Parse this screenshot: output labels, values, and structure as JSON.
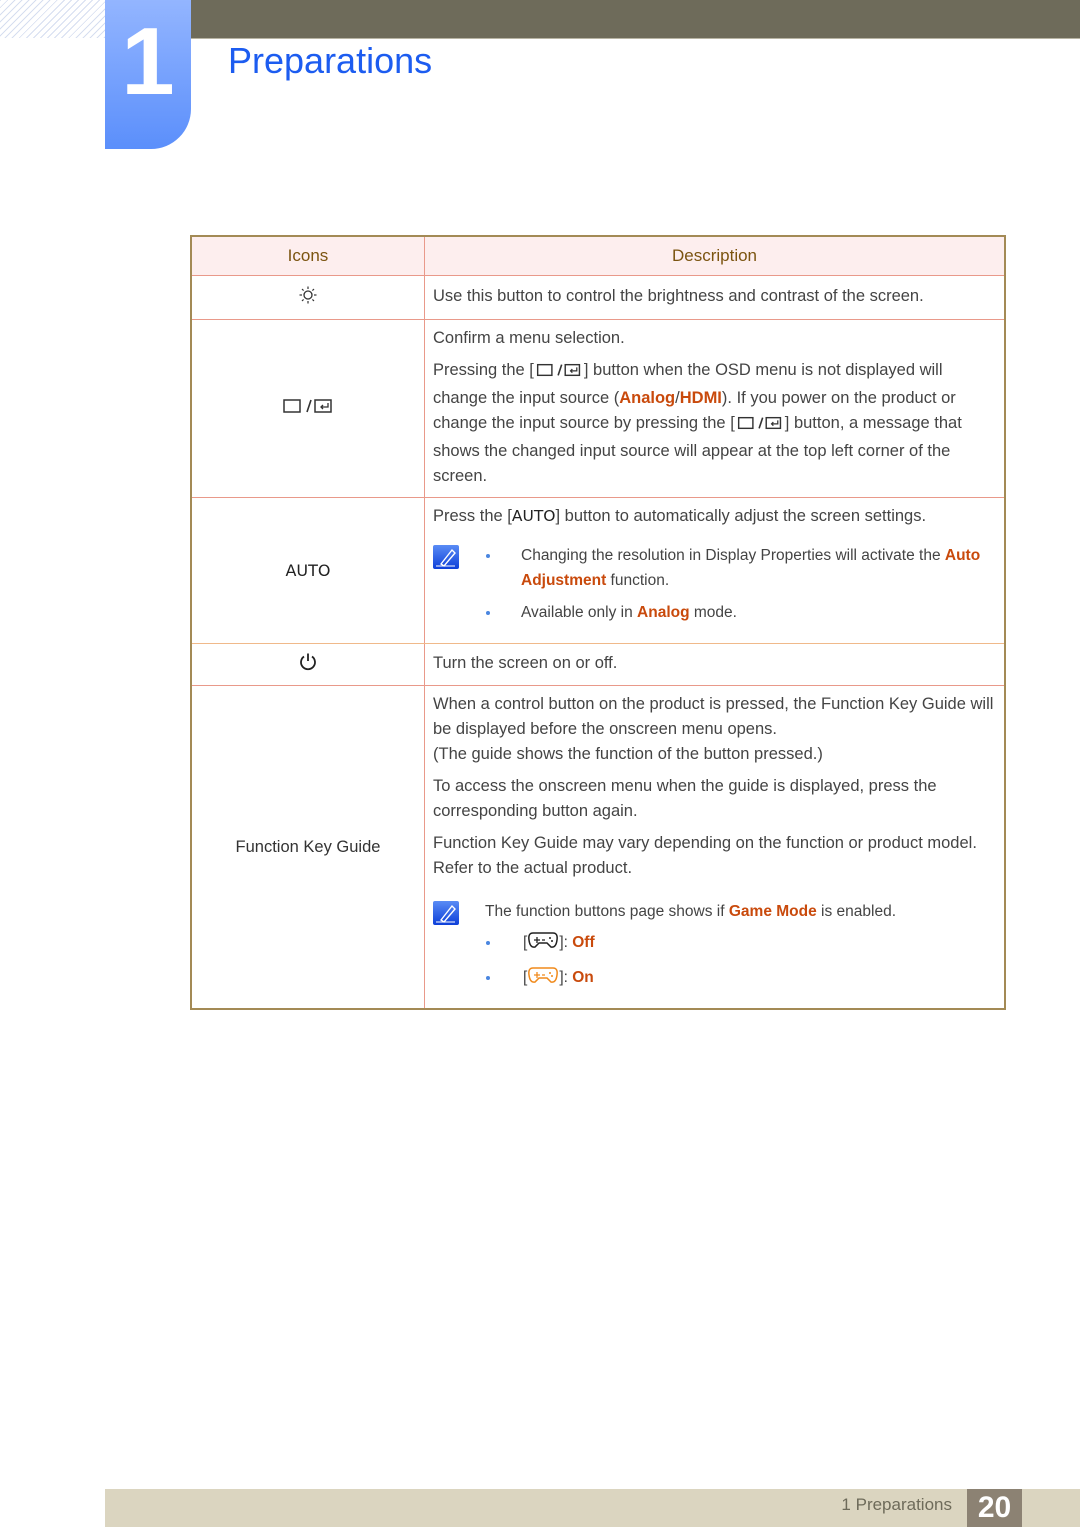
{
  "header": {
    "chapter_number": "1",
    "page_title": "Preparations"
  },
  "table": {
    "headers": {
      "icons": "Icons",
      "description": "Description"
    },
    "rows": [
      {
        "icon": "brightness-icon",
        "description": [
          "Use this button to control the brightness and contrast of the screen."
        ]
      },
      {
        "icon": "source-enter-icon",
        "description": {
          "p1": "Confirm a menu selection.",
          "p2_a": "Pressing the [",
          "p2_b": "] button when the OSD menu is not displayed will change the input source (",
          "p2_analog": "Analog",
          "p2_slash": "/",
          "p2_hdmi": "HDMI",
          "p2_c": "). If you power on the product or change the input source by pressing the [",
          "p2_d": "] button, a message that shows the changed input source will appear at the top left corner of the screen."
        }
      },
      {
        "icon_text": "AUTO",
        "description": {
          "p1_a": "Press the [",
          "p1_auto": "AUTO",
          "p1_b": "] button to automatically adjust the screen settings.",
          "note_items": [
            {
              "text": "Changing the resolution in Display Properties will activate the ",
              "hl": "Auto Adjustment",
              "after": " function."
            },
            {
              "text": "Available only in ",
              "hl": "Analog",
              "after": " mode."
            }
          ]
        }
      },
      {
        "icon": "power-icon",
        "description": [
          "Turn the screen on or off."
        ]
      },
      {
        "icon_text": "Function Key Guide",
        "description": {
          "p1": "When a control button on the product is pressed, the Function Key Guide will be displayed before the onscreen menu opens.",
          "p1b": "(The guide shows the function of the button pressed.)",
          "p2": "To access the onscreen menu when the guide is displayed, press the corresponding button again.",
          "p3": "Function Key Guide may vary depending on the function or product model. Refer to the actual product.",
          "note_lead_a": "The function buttons page shows if ",
          "note_lead_hl": "Game Mode",
          "note_lead_b": " is enabled.",
          "game_items": [
            {
              "icon": "gamepad-icon",
              "state": "Off",
              "icon_color": "#222222"
            },
            {
              "icon": "gamepad-icon",
              "state": "On",
              "icon_color": "#f08a1c"
            }
          ]
        }
      }
    ]
  },
  "footer": {
    "section_label": "1 Preparations",
    "page_number": "20"
  },
  "colors": {
    "title_blue": "#1c5cf0",
    "highlight": "#c94a0c",
    "topbar": "#6e6b5a",
    "footer_bg": "#dbd5c0",
    "page_badge": "#8c8273"
  }
}
